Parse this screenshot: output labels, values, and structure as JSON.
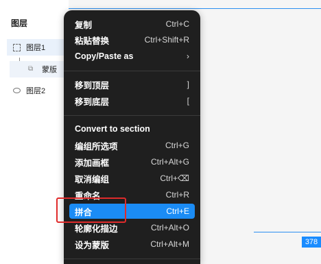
{
  "layers": {
    "title": "图层",
    "items": [
      {
        "label": "图层1",
        "icon": "frame-icon"
      },
      {
        "label": "蒙版",
        "icon": "mask-icon"
      },
      {
        "label": "图层2",
        "icon": "ellipse-icon"
      }
    ]
  },
  "canvas": {
    "dimension_badge": "378"
  },
  "menu": {
    "items": [
      {
        "label": "复制",
        "shortcut": "Ctrl+C"
      },
      {
        "label": "粘贴替换",
        "shortcut": "Ctrl+Shift+R"
      },
      {
        "label": "Copy/Paste as",
        "shortcut": "›"
      },
      {
        "label": "移到顶层",
        "shortcut": "]"
      },
      {
        "label": "移到底层",
        "shortcut": "["
      },
      {
        "label": "Convert to section",
        "shortcut": ""
      },
      {
        "label": "编组所选项",
        "shortcut": "Ctrl+G"
      },
      {
        "label": "添加画框",
        "shortcut": "Ctrl+Alt+G"
      },
      {
        "label": "取消编组",
        "shortcut": "Ctrl+⌫"
      },
      {
        "label": "重命名",
        "shortcut": "Ctrl+R"
      },
      {
        "label": "拼合",
        "shortcut": "Ctrl+E"
      },
      {
        "label": "轮廓化描边",
        "shortcut": "Ctrl+Alt+O"
      },
      {
        "label": "设为蒙版",
        "shortcut": "Ctrl+Alt+M"
      }
    ]
  },
  "colors": {
    "menu_bg": "#1f1f1f",
    "highlight": "#1b8cf5",
    "annotation": "#e02b2b"
  }
}
